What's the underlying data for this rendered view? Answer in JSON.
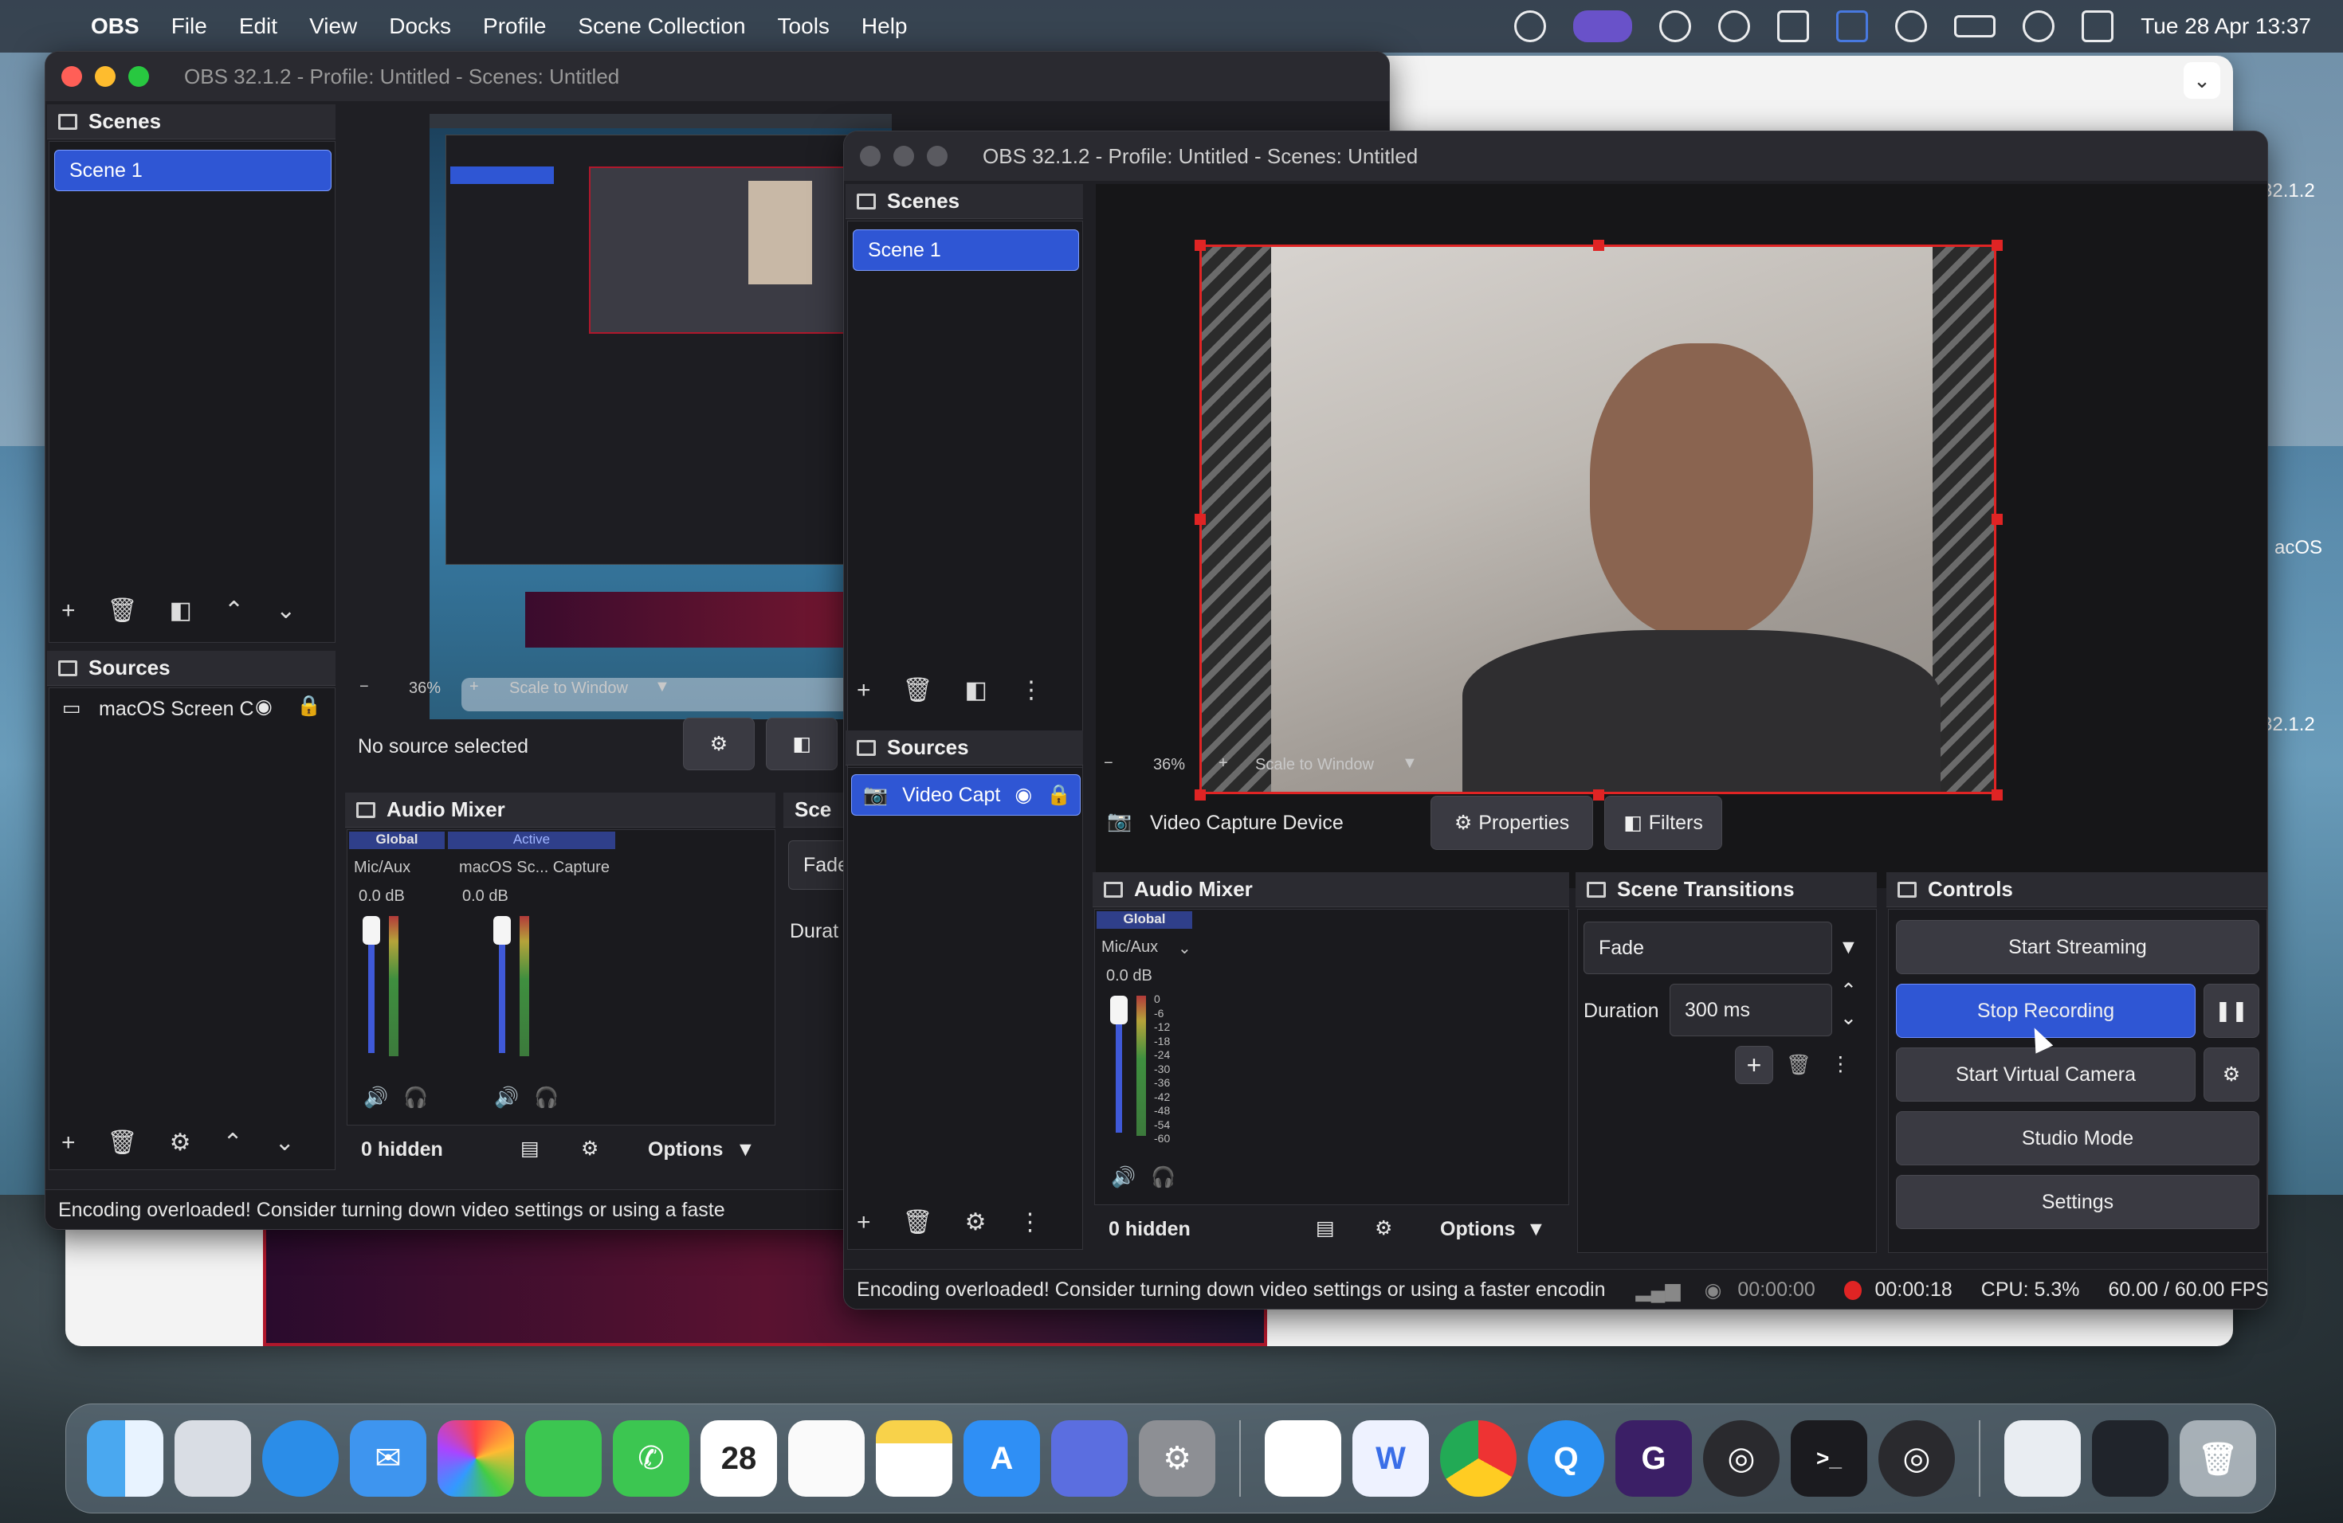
{
  "menubar": {
    "app": "OBS",
    "items": [
      "File",
      "Edit",
      "View",
      "Docks",
      "Profile",
      "Scene Collection",
      "Tools",
      "Help"
    ],
    "clock": "Tue 28 Apr  13:37"
  },
  "back_window": {
    "title": "OBS 32.1.2 - Profile: Untitled - Scenes: Untitled",
    "scenes_header": "Scenes",
    "scene_item": "Scene 1",
    "sources_header": "Sources",
    "source_item": "macOS Screen C",
    "zoom": "36%",
    "scale_mode": "Scale to Window",
    "no_source": "No source selected",
    "audio_header": "Audio Mixer",
    "tab_global": "Global",
    "tab_active": "Active",
    "ch1": "Mic/Aux",
    "ch2": "macOS Sc... Capture",
    "db1": "0.0 dB",
    "db2": "0.0 dB",
    "hidden": "0 hidden",
    "options": "Options",
    "trans_header_partial": "Sce",
    "fade_partial": "Fade",
    "dur_partial": "Durat",
    "status": "Encoding overloaded! Consider turning down video settings or using a faste"
  },
  "front_window": {
    "title": "OBS 32.1.2 - Profile: Untitled - Scenes: Untitled",
    "scenes_header": "Scenes",
    "scene_item": "Scene 1",
    "sources_header": "Sources",
    "source_item": "Video Capt",
    "zoom": "36%",
    "scale_mode": "Scale to Window",
    "source_label": "Video Capture Device",
    "properties": "Properties",
    "filters": "Filters",
    "audio_header": "Audio Mixer",
    "tab_global": "Global",
    "ch1": "Mic/Aux",
    "db1": "0.0 dB",
    "hidden": "0 hidden",
    "options": "Options",
    "transitions_header": "Scene Transitions",
    "transition": "Fade",
    "duration_label": "Duration",
    "duration_value": "300 ms",
    "controls_header": "Controls",
    "start_streaming": "Start Streaming",
    "stop_recording": "Stop Recording",
    "start_virtual_camera": "Start Virtual Camera",
    "studio_mode": "Studio Mode",
    "settings": "Settings",
    "status": "Encoding overloaded! Consider turning down video settings or using a faster encodin",
    "stream_time": "00:00:00",
    "record_time": "00:00:18",
    "cpu": "CPU: 5.3%",
    "fps": "60.00 / 60.00 FPS"
  },
  "meter_scale": [
    "0",
    "-6",
    "-12",
    "-18",
    "-24",
    "-30",
    "-36",
    "-42",
    "-48",
    "-54",
    "-60"
  ],
  "side_labels": {
    "v1": "32.1.2",
    "mac": "acOS",
    "v2": "32.1.2"
  },
  "calendar_day": "28",
  "colors": {
    "accent": "#2f56d4",
    "record": "#e02424",
    "panel": "#1a1a1e"
  }
}
